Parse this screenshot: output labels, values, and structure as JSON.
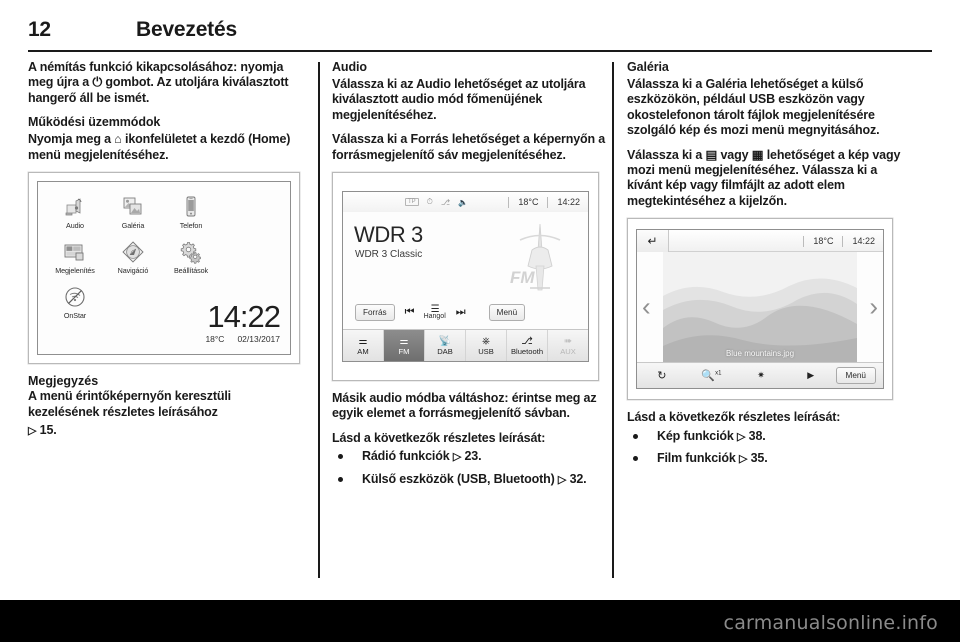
{
  "header": {
    "page_number": "12",
    "title": "Bevezetés"
  },
  "col1": {
    "p1": "A némítás funkció kikapcsolásához: nyomja meg újra a ⏻ gombot. Az utoljára kiválasztott hangerő áll be ismét.",
    "h_modes": "Működési üzemmódok",
    "p2": "Nyomja meg a ⌂ ikonfelületet a kezdő (Home) menü megjelenítéséhez.",
    "note_title": "Megjegyzés",
    "note_body": "A menü érintőképernyőn keresztüli kezelésének részletes leírásához",
    "note_ref": "15."
  },
  "home_screen": {
    "items": [
      {
        "label": "Audio",
        "icon": "audio-icon"
      },
      {
        "label": "Galéria",
        "icon": "gallery-icon"
      },
      {
        "label": "Telefon",
        "icon": "phone-icon"
      },
      {
        "label": "Megjelenítés",
        "icon": "display-icon"
      },
      {
        "label": "Navigáció",
        "icon": "navigation-icon"
      },
      {
        "label": "Beállítások",
        "icon": "settings-icon"
      },
      {
        "label": "OnStar",
        "icon": "onstar-icon"
      }
    ],
    "time": "14:22",
    "temperature": "18°C",
    "date": "02/13/2017"
  },
  "col2": {
    "h_audio": "Audio",
    "p1": "Válassza ki az Audio lehetőséget az utoljára kiválasztott audio mód főmenüjének megjelenítéséhez.",
    "p2": "Válassza ki a Forrás lehetőséget a képernyőn a forrásmegjelenítő sáv megjelenítéséhez.",
    "p3": "Másik audio módba váltáshoz: érintse meg az egyik elemet a forrásmegjelenítő sávban.",
    "see_details": "Lásd a következők részletes leírását:",
    "bullets": [
      {
        "text": "Rádió funkciók",
        "ref": "23."
      },
      {
        "text": "Külső eszközök (USB, Bluetooth)",
        "ref": "32."
      }
    ]
  },
  "radio_screen": {
    "status_icons": [
      "TP",
      "clock-icon",
      "bluetooth-icon",
      "mute-icon"
    ],
    "temperature": "18°C",
    "time": "14:22",
    "station": "WDR 3",
    "station_info": "WDR 3 Classic",
    "source_button": "Forrás",
    "menu_button": "Menü",
    "tune_label": "Hangol",
    "band_logo": "FM",
    "tabs": [
      {
        "label": "AM",
        "icon": "antenna-icon",
        "state": "normal"
      },
      {
        "label": "FM",
        "icon": "antenna-icon",
        "state": "active"
      },
      {
        "label": "DAB",
        "icon": "dab-icon",
        "state": "normal"
      },
      {
        "label": "USB",
        "icon": "usb-icon",
        "state": "normal"
      },
      {
        "label": "Bluetooth",
        "icon": "bluetooth-icon",
        "state": "normal"
      },
      {
        "label": "AUX",
        "icon": "aux-icon",
        "state": "disabled"
      }
    ]
  },
  "col3": {
    "h_gallery": "Galéria",
    "p1": "Válassza ki a Galéria lehetőséget a külső eszközökön, például USB eszközön vagy okostelefonon tárolt fájlok megjelenítésére szolgáló kép és mozi menü megnyitásához.",
    "p2": "Válassza ki a ▤ vagy ▦ lehetőséget a kép vagy mozi menü megjelenítéséhez. Válassza ki a kívánt kép vagy filmfájlt az adott elem megtekintéséhez a kijelzőn.",
    "see_details": "Lásd a következők részletes leírását:",
    "bullets": [
      {
        "text": "Kép funkciók",
        "ref": "38."
      },
      {
        "text": "Film funkciók",
        "ref": "35."
      }
    ]
  },
  "gallery_screen": {
    "back_icon": "back-arrow-icon",
    "temperature": "18°C",
    "time": "14:22",
    "filename": "Blue mountains.jpg",
    "prev_icon": "chevron-left-icon",
    "next_icon": "chevron-right-icon",
    "tools": [
      {
        "icon": "rotate-icon",
        "label": ""
      },
      {
        "icon": "zoom-icon",
        "label": "x1"
      },
      {
        "icon": "effects-icon",
        "label": ""
      },
      {
        "icon": "slideshow-icon",
        "label": ""
      }
    ],
    "menu_button": "Menü"
  },
  "watermark": "carmanualsonline.info",
  "ref_glyph": "▷"
}
